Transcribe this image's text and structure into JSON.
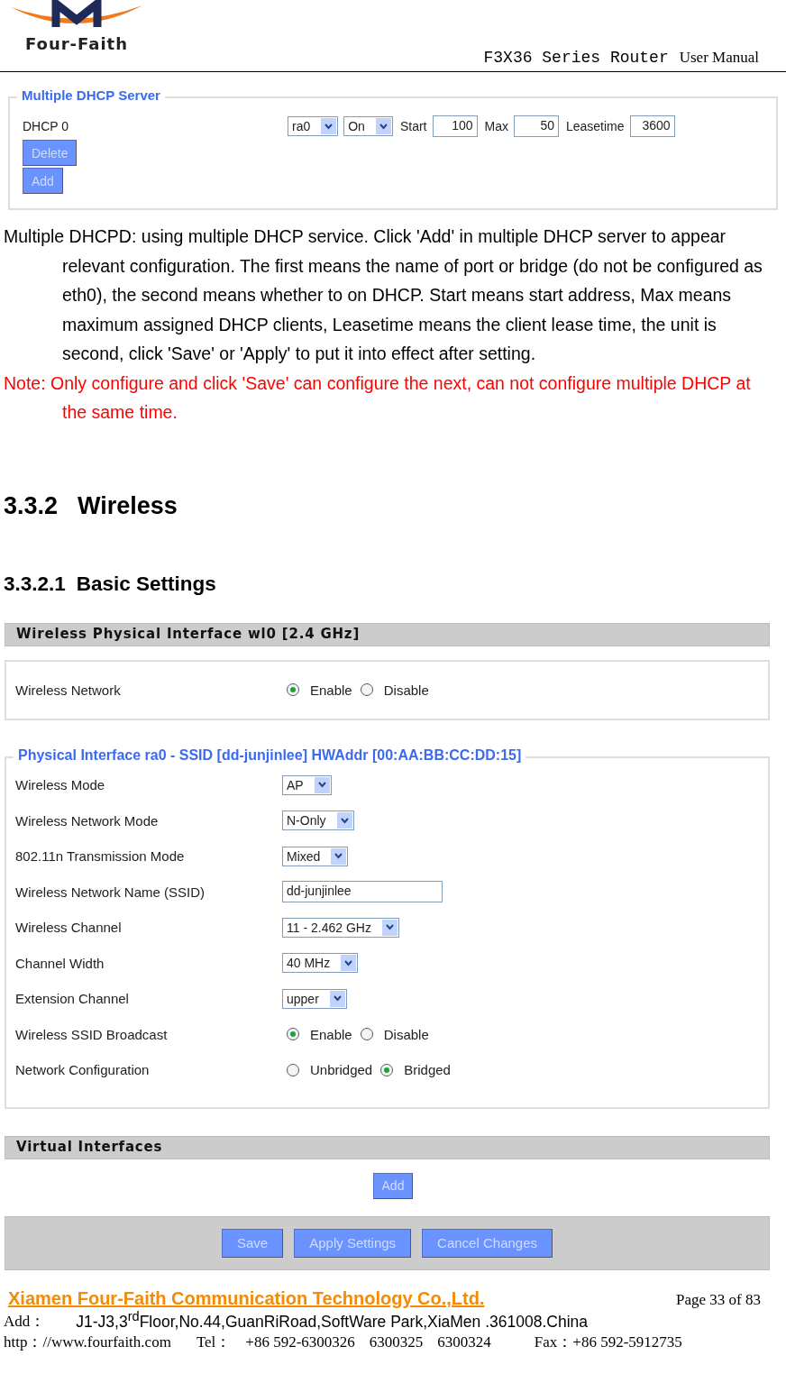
{
  "header": {
    "logo_text": "Four-Faith",
    "product": "F3X36 Series Router",
    "manual": "User Manual"
  },
  "dhcp_panel": {
    "legend": "Multiple DHCP Server",
    "label": "DHCP 0",
    "port": "ra0",
    "state": "On",
    "fields": [
      {
        "label": "Start",
        "value": "100"
      },
      {
        "label": "Max",
        "value": "50"
      },
      {
        "label": "Leasetime",
        "value": "3600"
      }
    ],
    "buttons": [
      "Delete",
      "Add"
    ]
  },
  "description": "Multiple DHCPD: using multiple DHCP service. Click 'Add' in multiple DHCP server to appear relevant configuration. The first means the name of port or bridge (do not be configured as eth0), the second means whether to on DHCP. Start means start address, Max means maximum assigned DHCP clients, Leasetime means the client lease time, the unit is second, click 'Save' or 'Apply' to put it into effect after setting.",
  "note": "Note: Only configure and click 'Save' can configure the next, can not configure multiple DHCP at the same time.",
  "section": {
    "number": "3.3.2",
    "title": "Wireless"
  },
  "subsection": {
    "number": "3.3.2.1",
    "title": "Basic Settings"
  },
  "physical_interface": {
    "title": "Wireless Physical Interface wl0 [2.4 GHz]",
    "label": "Wireless Network",
    "options": [
      {
        "label": "Enable",
        "selected": true
      },
      {
        "label": "Disable",
        "selected": false
      }
    ]
  },
  "interface_panel": {
    "legend": "Physical Interface ra0 - SSID [dd-junjinlee] HWAddr [00:AA:BB:CC:DD:15]",
    "rows": [
      {
        "kind": "select",
        "label": "Wireless Mode",
        "value": "AP"
      },
      {
        "kind": "select",
        "label": "Wireless Network Mode",
        "value": "N-Only"
      },
      {
        "kind": "select",
        "label": "802.11n Transmission Mode",
        "value": "Mixed"
      },
      {
        "kind": "input",
        "label": "Wireless Network Name (SSID)",
        "value": "dd-junjinlee"
      },
      {
        "kind": "select",
        "label": "Wireless Channel",
        "value": "11 - 2.462 GHz"
      },
      {
        "kind": "select",
        "label": "Channel Width",
        "value": "40 MHz"
      },
      {
        "kind": "select",
        "label": "Extension Channel",
        "value": "upper"
      },
      {
        "kind": "radio",
        "label": "Wireless SSID Broadcast",
        "options": [
          {
            "label": "Enable",
            "selected": true
          },
          {
            "label": "Disable",
            "selected": false
          }
        ]
      },
      {
        "kind": "radio",
        "label": "Network Configuration",
        "options": [
          {
            "label": "Unbridged",
            "selected": false
          },
          {
            "label": "Bridged",
            "selected": true
          }
        ]
      }
    ]
  },
  "virtual_interfaces": {
    "title": "Virtual Interfaces",
    "button": "Add"
  },
  "actions": [
    "Save",
    "Apply Settings",
    "Cancel Changes"
  ],
  "footer": {
    "company": "Xiamen Four-Faith Communication Technology Co.,Ltd.",
    "page": "Page 33 of 83",
    "address_label": "Add：",
    "address": "J1-J3,3$^{rd}$Floor,No.44,GuanRiRoad,SoftWare Park,XiaMen .361008.China",
    "web": "http：//www.fourfaith.com",
    "tel_label": "Tel：",
    "tel": [
      "+86 592-6300326",
      "6300325",
      "6300324"
    ],
    "fax": "Fax：+86 592-5912735"
  }
}
